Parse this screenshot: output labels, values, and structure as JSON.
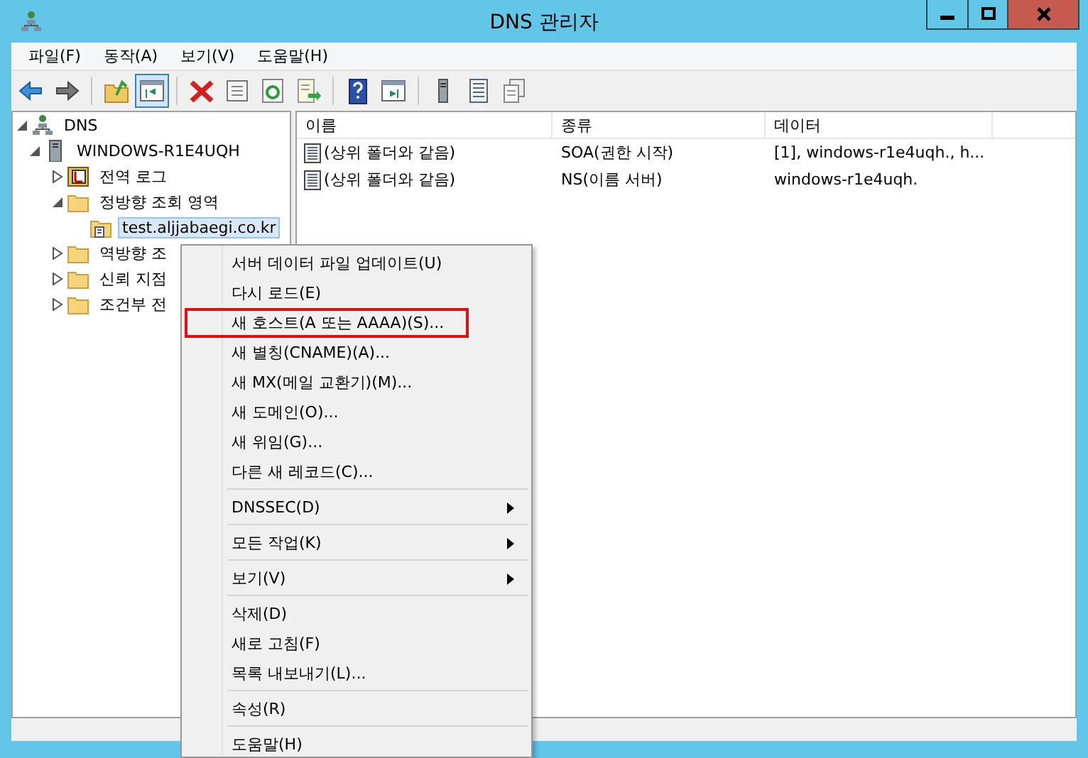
{
  "window": {
    "title": "DNS 관리자"
  },
  "menu_bar": [
    "파일(F)",
    "동작(A)",
    "보기(V)",
    "도움말(H)"
  ],
  "toolbar": [
    {
      "kind": "back",
      "pressed": false
    },
    {
      "kind": "forward",
      "pressed": false
    },
    {
      "kind": "sep"
    },
    {
      "kind": "up",
      "pressed": false
    },
    {
      "kind": "tree",
      "pressed": true
    },
    {
      "kind": "sep"
    },
    {
      "kind": "delete",
      "pressed": false
    },
    {
      "kind": "properties",
      "pressed": false
    },
    {
      "kind": "refresh",
      "pressed": false
    },
    {
      "kind": "export",
      "pressed": false
    },
    {
      "kind": "sep"
    },
    {
      "kind": "help",
      "pressed": false
    },
    {
      "kind": "pane",
      "pressed": false
    },
    {
      "kind": "sep"
    },
    {
      "kind": "server",
      "pressed": false
    },
    {
      "kind": "list",
      "pressed": false
    },
    {
      "kind": "copy",
      "pressed": false
    }
  ],
  "tree": [
    {
      "label": "DNS",
      "kind": "dns",
      "selected": false,
      "expanded": true,
      "children": [
        {
          "label": "WINDOWS-R1E4UQH",
          "kind": "server",
          "selected": false,
          "expanded": true,
          "children": [
            {
              "label": "전역 로그",
              "kind": "log",
              "selected": false,
              "expanded": false
            },
            {
              "label": "정방향 조회 영역",
              "kind": "folder",
              "selected": false,
              "expanded": true,
              "children": [
                {
                  "label": "test.aljjabaegi.co.kr",
                  "kind": "zone",
                  "selected": true
                }
              ]
            },
            {
              "label": "역방향 조",
              "kind": "folder",
              "selected": false,
              "expanded": false
            },
            {
              "label": "신뢰 지점",
              "kind": "folder",
              "selected": false,
              "expanded": false
            },
            {
              "label": "조건부 전",
              "kind": "folder",
              "selected": false,
              "expanded": false
            }
          ]
        }
      ]
    }
  ],
  "list": {
    "columns": [
      "이름",
      "종류",
      "데이터"
    ],
    "rows": [
      {
        "name": "(상위 폴더와 같음)",
        "type": "SOA(권한 시작)",
        "data": "[1], windows-r1e4uqh., h..."
      },
      {
        "name": "(상위 폴더와 같음)",
        "type": "NS(이름 서버)",
        "data": "windows-r1e4uqh."
      }
    ]
  },
  "context_menu": [
    {
      "label": "서버 데이터 파일 업데이트(U)",
      "kind": "item",
      "highlighted": false
    },
    {
      "label": "다시 로드(E)",
      "kind": "item",
      "highlighted": false
    },
    {
      "label": "새 호스트(A 또는 AAAA)(S)...",
      "kind": "item",
      "highlighted": true
    },
    {
      "label": "새 별칭(CNAME)(A)...",
      "kind": "item",
      "highlighted": false
    },
    {
      "label": "새 MX(메일 교환기)(M)...",
      "kind": "item",
      "highlighted": false
    },
    {
      "label": "새 도메인(O)...",
      "kind": "item",
      "highlighted": false
    },
    {
      "label": "새 위임(G)...",
      "kind": "item",
      "highlighted": false
    },
    {
      "label": "다른 새 레코드(C)...",
      "kind": "item",
      "highlighted": false
    },
    {
      "kind": "separator"
    },
    {
      "label": "DNSSEC(D)",
      "kind": "submenu",
      "highlighted": false
    },
    {
      "kind": "separator"
    },
    {
      "label": "모든 작업(K)",
      "kind": "submenu",
      "highlighted": false
    },
    {
      "kind": "separator"
    },
    {
      "label": "보기(V)",
      "kind": "submenu",
      "highlighted": false
    },
    {
      "kind": "separator"
    },
    {
      "label": "삭제(D)",
      "kind": "item",
      "highlighted": false
    },
    {
      "label": "새로 고침(F)",
      "kind": "item",
      "highlighted": false
    },
    {
      "label": "목록 내보내기(L)...",
      "kind": "item",
      "highlighted": false
    },
    {
      "kind": "separator"
    },
    {
      "label": "속성(R)",
      "kind": "item",
      "highlighted": false
    },
    {
      "kind": "separator"
    },
    {
      "label": "도움말(H)",
      "kind": "item",
      "highlighted": false
    }
  ]
}
